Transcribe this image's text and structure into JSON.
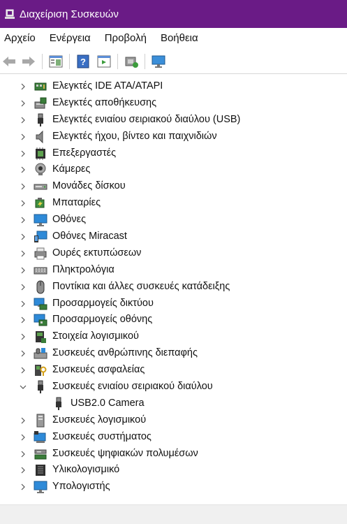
{
  "window": {
    "title": "Διαχείριση Συσκευών",
    "accent": "#6a1b86"
  },
  "menu": [
    "Αρχείο",
    "Ενέργεια",
    "Προβολή",
    "Βοήθεια"
  ],
  "toolbar": [
    "back-icon",
    "forward-icon",
    "properties-icon",
    "help-icon",
    "action-pane-icon",
    "scan-hardware-icon",
    "monitor-icon"
  ],
  "tree": [
    {
      "label": "Ελεγκτές IDE ATA/ATAPI",
      "icon": "ide-controller-icon",
      "expanded": false,
      "child": false
    },
    {
      "label": "Ελεγκτές αποθήκευσης",
      "icon": "storage-controller-icon",
      "expanded": false,
      "child": false
    },
    {
      "label": "Ελεγκτές ενιαίου σειριακού διαύλου (USB)",
      "icon": "usb-controller-icon",
      "expanded": false,
      "child": false
    },
    {
      "label": "Ελεγκτές ήχου, βίντεο και παιχνιδιών",
      "icon": "speaker-icon",
      "expanded": false,
      "child": false
    },
    {
      "label": "Επεξεργαστές",
      "icon": "processor-icon",
      "expanded": false,
      "child": false
    },
    {
      "label": "Κάμερες",
      "icon": "camera-icon",
      "expanded": false,
      "child": false
    },
    {
      "label": "Μονάδες δίσκου",
      "icon": "disk-drive-icon",
      "expanded": false,
      "child": false
    },
    {
      "label": "Μπαταρίες",
      "icon": "battery-icon",
      "expanded": false,
      "child": false
    },
    {
      "label": "Οθόνες",
      "icon": "display-icon",
      "expanded": false,
      "child": false
    },
    {
      "label": "Οθόνες Miracast",
      "icon": "miracast-display-icon",
      "expanded": false,
      "child": false
    },
    {
      "label": "Ουρές εκτυπώσεων",
      "icon": "printer-icon",
      "expanded": false,
      "child": false
    },
    {
      "label": "Πληκτρολόγια",
      "icon": "keyboard-icon",
      "expanded": false,
      "child": false
    },
    {
      "label": "Ποντίκια και άλλες συσκευές κατάδειξης",
      "icon": "mouse-icon",
      "expanded": false,
      "child": false
    },
    {
      "label": "Προσαρμογείς δικτύου",
      "icon": "network-adapter-icon",
      "expanded": false,
      "child": false
    },
    {
      "label": "Προσαρμογείς οθόνης",
      "icon": "display-adapter-icon",
      "expanded": false,
      "child": false
    },
    {
      "label": "Στοιχεία λογισμικού",
      "icon": "software-component-icon",
      "expanded": false,
      "child": false
    },
    {
      "label": "Συσκευές ανθρώπινης διεπαφής",
      "icon": "hid-icon",
      "expanded": false,
      "child": false
    },
    {
      "label": "Συσκευές ασφαλείας",
      "icon": "security-device-icon",
      "expanded": false,
      "child": false
    },
    {
      "label": "Συσκευές ενιαίου σειριακού διαύλου",
      "icon": "usb-device-icon",
      "expanded": true,
      "child": false
    },
    {
      "label": "USB2.0 Camera",
      "icon": "usb-plug-icon",
      "expanded": false,
      "child": true
    },
    {
      "label": "Συσκευές λογισμικού",
      "icon": "software-device-icon",
      "expanded": false,
      "child": false
    },
    {
      "label": "Συσκευές συστήματος",
      "icon": "system-device-icon",
      "expanded": false,
      "child": false
    },
    {
      "label": "Συσκευές ψηφιακών πολυμέσων",
      "icon": "media-device-icon",
      "expanded": false,
      "child": false
    },
    {
      "label": "Υλικολογισμικό",
      "icon": "firmware-icon",
      "expanded": false,
      "child": false
    },
    {
      "label": "Υπολογιστής",
      "icon": "computer-icon",
      "expanded": false,
      "child": false
    }
  ]
}
